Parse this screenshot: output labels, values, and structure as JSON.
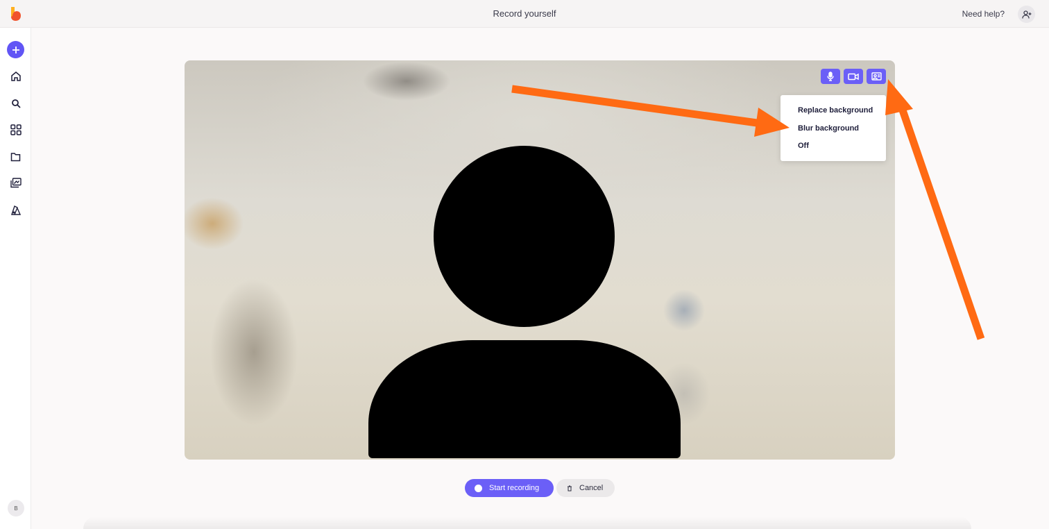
{
  "header": {
    "title": "Record yourself",
    "help_label": "Need help?"
  },
  "sidebar": {
    "items": [
      {
        "icon": "plus-icon"
      },
      {
        "icon": "home-icon"
      },
      {
        "icon": "search-icon"
      },
      {
        "icon": "grid-icon"
      },
      {
        "icon": "folder-icon"
      },
      {
        "icon": "media-library-icon"
      },
      {
        "icon": "brand-kit-icon"
      }
    ],
    "avatar_initial": "B"
  },
  "stage": {
    "controls": [
      "microphone-icon",
      "camera-icon",
      "background-icon"
    ],
    "background_menu": {
      "items": [
        "Replace background",
        "Blur background",
        "Off"
      ]
    }
  },
  "actions": {
    "start_label": "Start recording",
    "cancel_label": "Cancel"
  },
  "colors": {
    "accent": "#6b5ff7",
    "arrow": "#ff6a13",
    "logo": "#f0532d"
  }
}
